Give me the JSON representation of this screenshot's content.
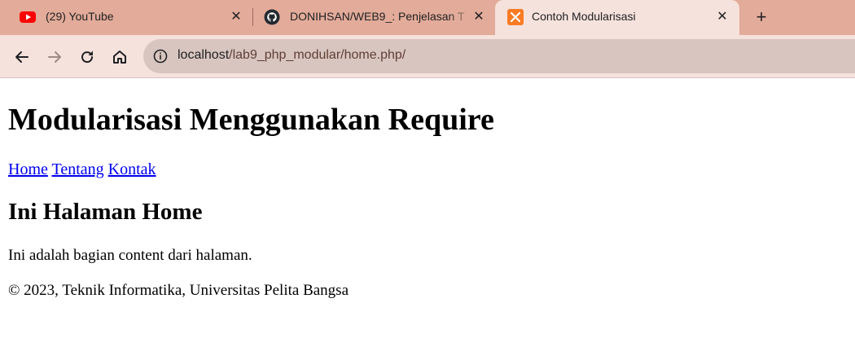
{
  "browser": {
    "tabs": [
      {
        "title": "(29) YouTube",
        "icon": "youtube-icon",
        "active": false
      },
      {
        "title": "DONIHSAN/WEB9_: Penjelasan T",
        "icon": "github-icon",
        "active": false
      },
      {
        "title": "Contoh Modularisasi",
        "icon": "xampp-icon",
        "active": true
      }
    ],
    "new_tab_label": "+",
    "close_label": "✕",
    "address": {
      "host": "localhost",
      "path": "/lab9_php_modular/home.php/"
    },
    "colors": {
      "tabstrip": "#e3ab99",
      "active_tab": "#f6e2dc",
      "omnibox": "#d8c5bf"
    }
  },
  "page": {
    "heading": "Modularisasi Menggunakan Require",
    "nav": {
      "home": "Home",
      "tentang": "Tentang",
      "kontak": "Kontak"
    },
    "subheading": "Ini Halaman Home",
    "content": "Ini adalah bagian content dari halaman.",
    "footer": "© 2023, Teknik Informatika, Universitas Pelita Bangsa",
    "link_color": "#0000ee"
  }
}
